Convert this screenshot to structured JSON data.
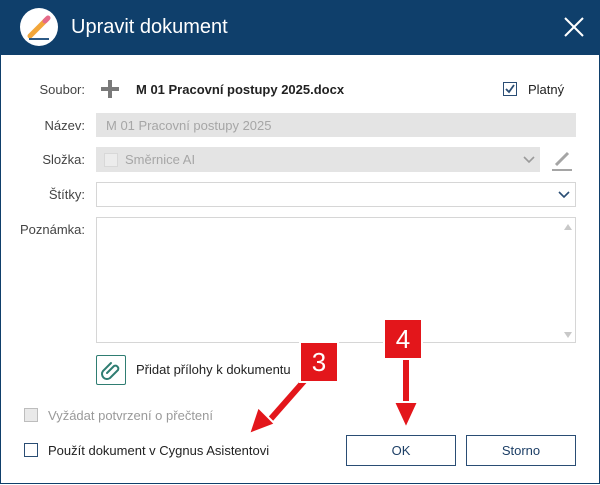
{
  "dialog": {
    "title": "Upravit dokument"
  },
  "form": {
    "file_label": "Soubor:",
    "file_name": "M 01 Pracovní postupy 2025.docx",
    "valid_label": "Platný",
    "valid_checked": true,
    "name_label": "Název:",
    "name_value": "M 01 Pracovní postupy 2025",
    "folder_label": "Složka:",
    "folder_value": "Směrnice AI",
    "tags_label": "Štítky:",
    "tags_value": "",
    "note_label": "Poznámka:",
    "note_value": ""
  },
  "attachments": {
    "label": "Přidat přílohy k dokumentu"
  },
  "options": {
    "request_read_confirmation": "Vyžádat potvrzení o přečtení",
    "use_in_cygnus": "Použít dokument v Cygnus Asistentovi"
  },
  "buttons": {
    "ok": "OK",
    "cancel": "Storno"
  },
  "annotations": {
    "badge_3": "3",
    "badge_4": "4",
    "color": "#e3161b"
  },
  "colors": {
    "titlebar": "#0f3f6b",
    "accent": "#2a4d74"
  }
}
